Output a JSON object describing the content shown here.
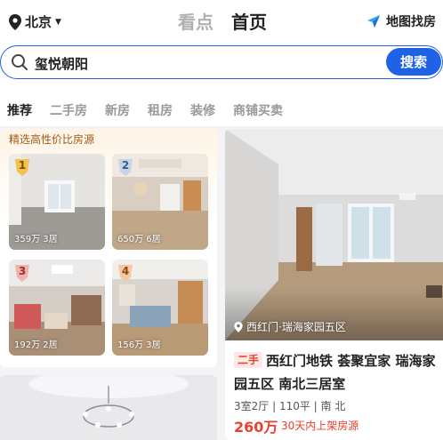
{
  "header": {
    "city": "北京",
    "tabs": [
      {
        "label": "看点",
        "active": false
      },
      {
        "label": "首页",
        "active": true
      }
    ],
    "map_find_label": "地图找房"
  },
  "search": {
    "value": "玺悦朝阳",
    "button_label": "搜索"
  },
  "categories": [
    "推荐",
    "二手房",
    "新房",
    "租房",
    "装修",
    "商铺买卖"
  ],
  "picks": {
    "title": "精选高性价比房源",
    "items": [
      {
        "rank": "1",
        "caption": "359万 3居"
      },
      {
        "rank": "2",
        "caption": "650万 6居"
      },
      {
        "rank": "3",
        "caption": "192万 2居"
      },
      {
        "rank": "4",
        "caption": "156万 3居"
      }
    ]
  },
  "listing": {
    "location": "西红门·瑞海家园五区",
    "tag": "二手",
    "title": "西红门地铁 荟聚宜家 瑞海家园五区 南北三居室",
    "spec": "3室2厅 | 110平 | 南 北",
    "price": "260万",
    "badge": "30天内上架房源"
  },
  "colors": {
    "brand_blue": "#1e62e6",
    "price_red": "#e8402e",
    "pick_title_brown": "#a15a14"
  },
  "icons": {
    "city_pin": "location-pin-icon",
    "city_caret": "caret-down-icon",
    "map": "navigation-arrow-icon",
    "search": "search-icon",
    "listing_pin": "location-pin-icon"
  }
}
